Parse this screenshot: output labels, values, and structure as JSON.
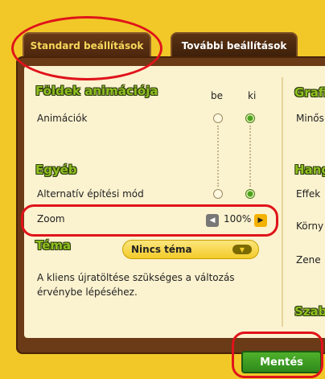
{
  "tabs": {
    "standard": "Standard beállítások",
    "more": "További beállítások"
  },
  "sections": {
    "ground_anim": "Földek animációja",
    "other": "Egyéb",
    "theme": "Téma",
    "right_1": "Grafi",
    "right_2": "Hang",
    "right_3": "Szab"
  },
  "columns": {
    "on": "be",
    "off": "ki"
  },
  "rows": {
    "animations": "Animációk",
    "alt_build": "Alternatív építési mód",
    "zoom": "Zoom"
  },
  "zoom": {
    "value": "100%"
  },
  "theme_select": {
    "value": "Nincs téma"
  },
  "note": "A kliens újratöltése szükséges a változás érvénybe lépéséhez.",
  "right_labels": {
    "quality": "Minős",
    "effects": "Effek",
    "env": "Körny",
    "zone": "Zene"
  },
  "buttons": {
    "save": "Mentés"
  },
  "colors": {
    "accent": "#8fbf20",
    "highlight": "#e0131a"
  }
}
